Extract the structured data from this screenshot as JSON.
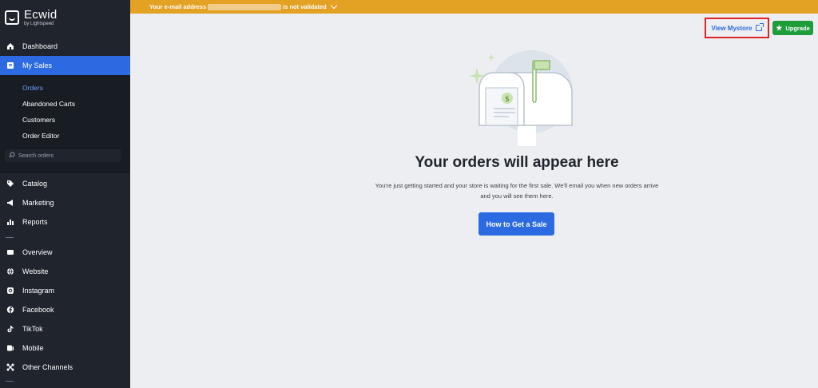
{
  "brand": {
    "name": "Ecwid",
    "sub": "by Lightspeed"
  },
  "banner": {
    "prefix": "Your e-mail address",
    "suffix": "is not validated"
  },
  "sidebar": {
    "top_items": [
      {
        "label": "Dashboard",
        "icon": "home-icon"
      },
      {
        "label": "My Sales",
        "icon": "sales-icon"
      }
    ],
    "sub_items": [
      {
        "label": "Orders"
      },
      {
        "label": "Abandoned Carts"
      },
      {
        "label": "Customers"
      },
      {
        "label": "Order Editor"
      }
    ],
    "search_placeholder": "Search orders",
    "mid_items": [
      {
        "label": "Catalog",
        "icon": "tag-icon"
      },
      {
        "label": "Marketing",
        "icon": "megaphone-icon"
      },
      {
        "label": "Reports",
        "icon": "chart-icon"
      }
    ],
    "channel_items": [
      {
        "label": "Overview",
        "icon": "overview-icon"
      },
      {
        "label": "Website",
        "icon": "globe-icon"
      },
      {
        "label": "Instagram",
        "icon": "instagram-icon"
      },
      {
        "label": "Facebook",
        "icon": "facebook-icon"
      },
      {
        "label": "TikTok",
        "icon": "tiktok-icon"
      },
      {
        "label": "Mobile",
        "icon": "mobile-icon"
      },
      {
        "label": "Other Channels",
        "icon": "channels-icon"
      }
    ]
  },
  "header": {
    "view_store": "View Mystore",
    "upgrade": "Upgrade"
  },
  "empty_state": {
    "title": "Your orders will appear here",
    "line1": "You're just getting started and your store is waiting for the first sale. We'll email you when new orders arrive",
    "line2": "and you will see them here.",
    "cta": "How to Get a Sale"
  },
  "colors": {
    "accent": "#2b6ae0",
    "banner": "#e3a224",
    "sidebar": "#1f242d",
    "upgrade": "#1f9d3b"
  }
}
